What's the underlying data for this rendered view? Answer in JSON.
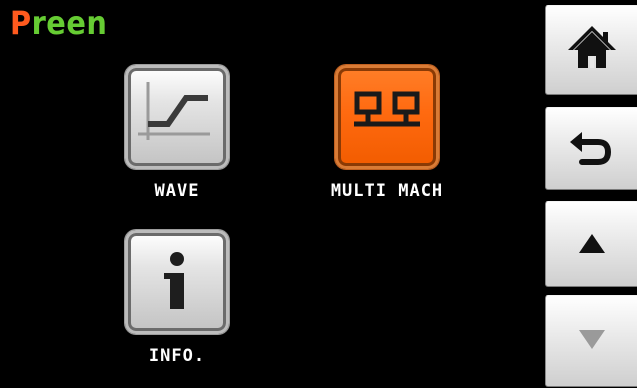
{
  "brand": {
    "letters": [
      {
        "ch": "P",
        "color": "#ff5a1e"
      },
      {
        "ch": "r",
        "color": "#66cc33"
      },
      {
        "ch": "e",
        "color": "#66cc33"
      },
      {
        "ch": "e",
        "color": "#66cc33"
      },
      {
        "ch": "n",
        "color": "#66cc33"
      }
    ]
  },
  "tiles": {
    "wave": {
      "label": "WAVE",
      "icon": "wave-curve-icon",
      "selected": false
    },
    "multi_mach": {
      "label": "MULTI MACH",
      "icon": "network-icon",
      "selected": true
    },
    "info": {
      "label": "INFO.",
      "icon": "info-icon",
      "selected": false
    }
  },
  "nav": {
    "home": {
      "icon": "home-icon"
    },
    "back": {
      "icon": "back-arrow-icon"
    },
    "up": {
      "icon": "up-triangle-icon"
    },
    "down": {
      "icon": "down-triangle-icon",
      "disabled": true
    }
  },
  "colors": {
    "background": "#000000",
    "accent_orange": "#ff6a10",
    "brand_green": "#66cc33",
    "brand_red": "#ff5a1e"
  }
}
